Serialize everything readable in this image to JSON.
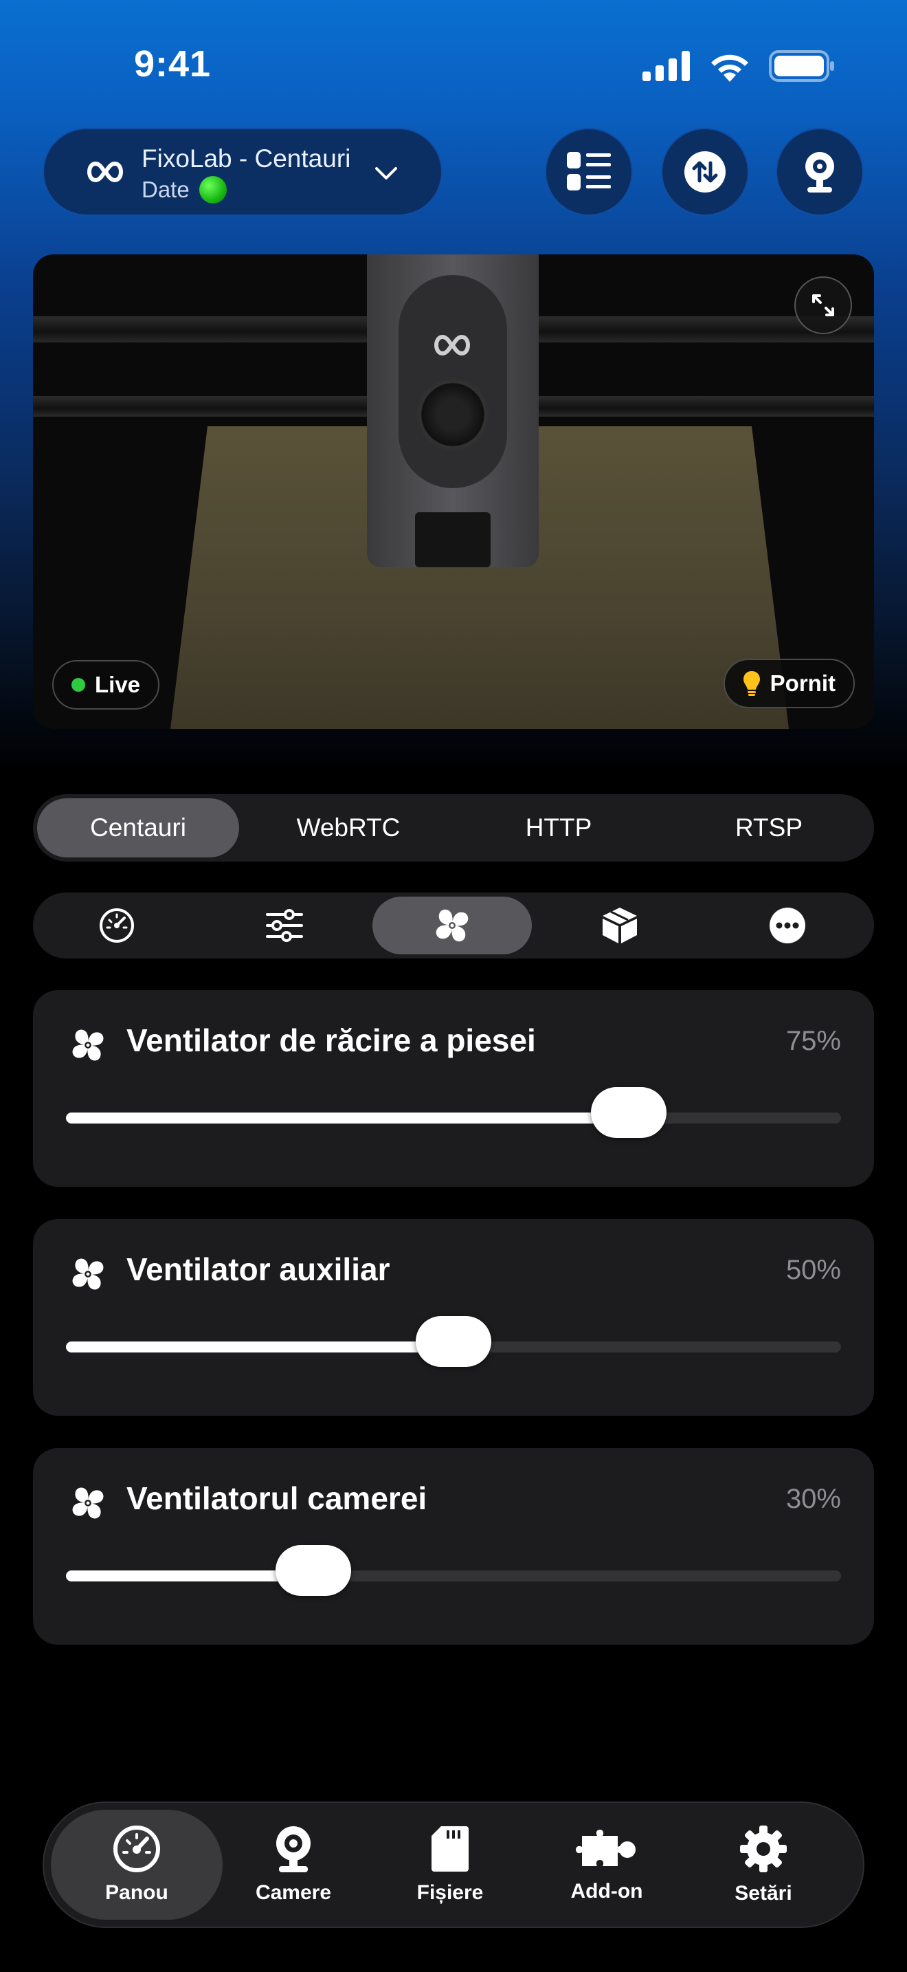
{
  "status_bar": {
    "time": "9:41"
  },
  "header": {
    "printer_name": "FixoLab - Centauri",
    "printer_status": "Date",
    "icons": [
      "list-icon",
      "transfer-icon",
      "webcam-icon"
    ]
  },
  "camera": {
    "live_label": "Live",
    "light_label": "Pornit"
  },
  "source_tabs": [
    {
      "label": "Centauri",
      "active": true
    },
    {
      "label": "WebRTC",
      "active": false
    },
    {
      "label": "HTTP",
      "active": false
    },
    {
      "label": "RTSP",
      "active": false
    }
  ],
  "control_tabs": [
    {
      "icon": "gauge-icon",
      "active": false
    },
    {
      "icon": "sliders-icon",
      "active": false
    },
    {
      "icon": "fan-icon",
      "active": true
    },
    {
      "icon": "box-icon",
      "active": false
    },
    {
      "icon": "more-icon",
      "active": false
    }
  ],
  "fans": [
    {
      "label": "Ventilator de răcire a piesei",
      "value_text": "75%",
      "value": 75
    },
    {
      "label": "Ventilator auxiliar",
      "value_text": "50%",
      "value": 50
    },
    {
      "label": "Ventilatorul camerei",
      "value_text": "30%",
      "value": 30
    }
  ],
  "nav": [
    {
      "label": "Panou",
      "icon": "dashboard-icon",
      "active": true
    },
    {
      "label": "Camere",
      "icon": "camera-icon",
      "active": false
    },
    {
      "label": "Fișiere",
      "icon": "sd-card-icon",
      "active": false
    },
    {
      "label": "Add-on",
      "icon": "puzzle-icon",
      "active": false
    },
    {
      "label": "Setări",
      "icon": "gear-icon",
      "active": false
    }
  ],
  "colors": {
    "accent_blue": "#0a6fd0",
    "card_bg": "#1c1c1e",
    "live_green": "#2ecc40"
  }
}
